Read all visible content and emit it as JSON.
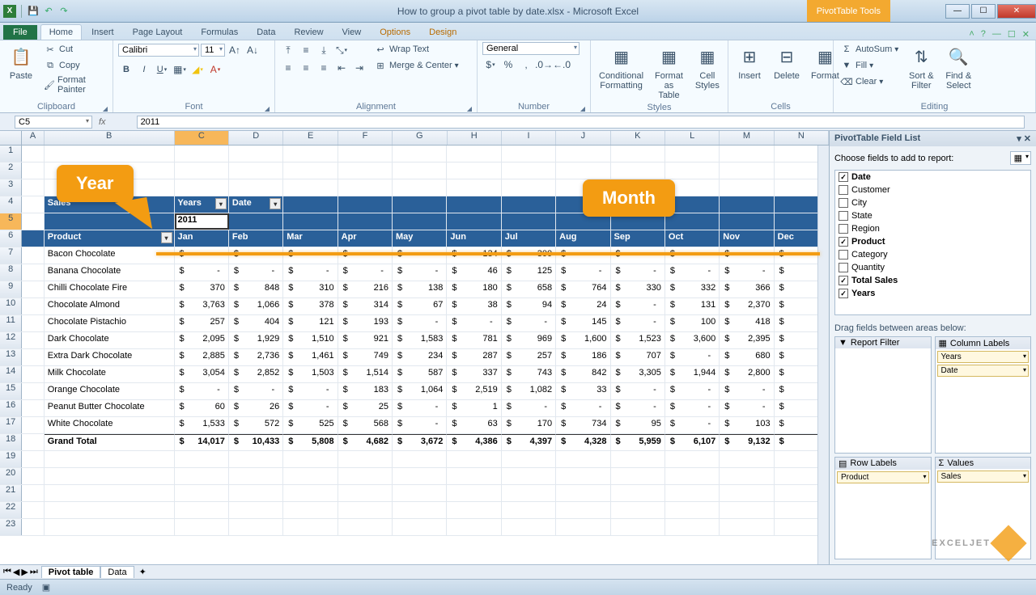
{
  "title": "How to group a pivot table by date.xlsx - Microsoft Excel",
  "contextual_title": "PivotTable Tools",
  "file_tab": "File",
  "tabs": [
    "Home",
    "Insert",
    "Page Layout",
    "Formulas",
    "Data",
    "Review",
    "View",
    "Options",
    "Design"
  ],
  "active_tab": "Home",
  "ribbon": {
    "clipboard": {
      "paste": "Paste",
      "cut": "Cut",
      "copy": "Copy",
      "fp": "Format Painter",
      "label": "Clipboard"
    },
    "font": {
      "label": "Font",
      "name": "Calibri",
      "size": "11"
    },
    "alignment": {
      "label": "Alignment",
      "wrap": "Wrap Text",
      "merge": "Merge & Center"
    },
    "number": {
      "label": "Number",
      "format": "General"
    },
    "styles": {
      "label": "Styles",
      "cf": "Conditional\nFormatting",
      "fat": "Format\nas Table",
      "cs": "Cell\nStyles"
    },
    "cells": {
      "label": "Cells",
      "ins": "Insert",
      "del": "Delete",
      "fmt": "Format"
    },
    "editing": {
      "label": "Editing",
      "sum": "AutoSum",
      "fill": "Fill",
      "clear": "Clear",
      "sort": "Sort &\nFilter",
      "find": "Find &\nSelect"
    }
  },
  "namebox": "C5",
  "formula": "2011",
  "columns": [
    "A",
    "B",
    "C",
    "D",
    "E",
    "F",
    "G",
    "H",
    "I",
    "J",
    "K",
    "L",
    "M",
    "N"
  ],
  "months": [
    "Jan",
    "Feb",
    "Mar",
    "Apr",
    "May",
    "Jun",
    "Jul",
    "Aug",
    "Sep",
    "Oct",
    "Nov",
    "Dec"
  ],
  "pivot": {
    "sales_label": "Sales",
    "years_label": "Years",
    "date_label": "Date",
    "year_value": "2011",
    "product_label": "Product",
    "grand_label": "Grand Total"
  },
  "rows": [
    {
      "name": "Bacon Chocolate",
      "vals": [
        "-",
        "-",
        "-",
        "-",
        "-",
        "134",
        "300",
        "-",
        "-",
        "-",
        "-",
        ""
      ]
    },
    {
      "name": "Banana Chocolate",
      "vals": [
        "-",
        "-",
        "-",
        "-",
        "-",
        "46",
        "125",
        "-",
        "-",
        "-",
        "-",
        ""
      ]
    },
    {
      "name": "Chilli Chocolate Fire",
      "vals": [
        "370",
        "848",
        "310",
        "216",
        "138",
        "180",
        "658",
        "764",
        "330",
        "332",
        "366",
        ""
      ]
    },
    {
      "name": "Chocolate Almond",
      "vals": [
        "3,763",
        "1,066",
        "378",
        "314",
        "67",
        "38",
        "94",
        "24",
        "-",
        "131",
        "2,370",
        ""
      ]
    },
    {
      "name": "Chocolate Pistachio",
      "vals": [
        "257",
        "404",
        "121",
        "193",
        "-",
        "-",
        "-",
        "145",
        "-",
        "100",
        "418",
        ""
      ]
    },
    {
      "name": "Dark Chocolate",
      "vals": [
        "2,095",
        "1,929",
        "1,510",
        "921",
        "1,583",
        "781",
        "969",
        "1,600",
        "1,523",
        "3,600",
        "2,395",
        ""
      ]
    },
    {
      "name": "Extra Dark Chocolate",
      "vals": [
        "2,885",
        "2,736",
        "1,461",
        "749",
        "234",
        "287",
        "257",
        "186",
        "707",
        "-",
        "680",
        ""
      ]
    },
    {
      "name": "Milk Chocolate",
      "vals": [
        "3,054",
        "2,852",
        "1,503",
        "1,514",
        "587",
        "337",
        "743",
        "842",
        "3,305",
        "1,944",
        "2,800",
        ""
      ]
    },
    {
      "name": "Orange Chocolate",
      "vals": [
        "-",
        "-",
        "-",
        "183",
        "1,064",
        "2,519",
        "1,082",
        "33",
        "-",
        "-",
        "-",
        ""
      ]
    },
    {
      "name": "Peanut Butter Chocolate",
      "vals": [
        "60",
        "26",
        "-",
        "25",
        "-",
        "1",
        "-",
        "-",
        "-",
        "-",
        "-",
        ""
      ]
    },
    {
      "name": "White Chocolate",
      "vals": [
        "1,533",
        "572",
        "525",
        "568",
        "-",
        "63",
        "170",
        "734",
        "95",
        "-",
        "103",
        ""
      ]
    }
  ],
  "totals": [
    "14,017",
    "10,433",
    "5,808",
    "4,682",
    "3,672",
    "4,386",
    "4,397",
    "4,328",
    "5,959",
    "6,107",
    "9,132",
    ""
  ],
  "callouts": {
    "year": "Year",
    "month": "Month"
  },
  "fieldpane": {
    "title": "PivotTable Field List",
    "prompt": "Choose fields to add to report:",
    "fields": [
      {
        "name": "Date",
        "checked": true
      },
      {
        "name": "Customer",
        "checked": false
      },
      {
        "name": "City",
        "checked": false
      },
      {
        "name": "State",
        "checked": false
      },
      {
        "name": "Region",
        "checked": false
      },
      {
        "name": "Product",
        "checked": true
      },
      {
        "name": "Category",
        "checked": false
      },
      {
        "name": "Quantity",
        "checked": false
      },
      {
        "name": "Total Sales",
        "checked": true
      },
      {
        "name": "Years",
        "checked": true
      }
    ],
    "drag_label": "Drag fields between areas below:",
    "areas": {
      "filter": "Report Filter",
      "cols": "Column Labels",
      "rows": "Row Labels",
      "vals": "Values",
      "col_items": [
        "Years",
        "Date"
      ],
      "row_items": [
        "Product"
      ],
      "val_items": [
        "Sales"
      ]
    }
  },
  "sheets": {
    "active": "Pivot table",
    "other": "Data"
  },
  "status": "Ready",
  "watermark": "EXCELJET"
}
